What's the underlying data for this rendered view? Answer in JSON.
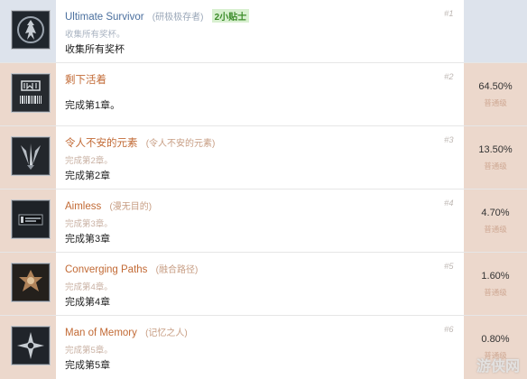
{
  "achievements": [
    {
      "name": "Ultimate Survivor",
      "subtitle": "(研极极存者)",
      "tips": "2小贴士",
      "desc_hidden": "收集所有奖杯。",
      "desc": "收集所有奖杯",
      "num": "#1",
      "percent": "",
      "rarity": "",
      "icon": "survivor-figure-icon",
      "unlocked": true
    },
    {
      "name": "剩下活着",
      "subtitle": "",
      "tips": "",
      "desc_hidden": "",
      "desc": "完成第1章。",
      "num": "#2",
      "percent": "64.50%",
      "rarity": "普通级",
      "icon": "left-alive-barcode-icon",
      "unlocked": false
    },
    {
      "name": "令人不安的元素",
      "subtitle": "(令人不安的元素)",
      "tips": "",
      "desc_hidden": "完成第2章。",
      "desc": "完成第2章",
      "num": "#3",
      "percent": "13.50%",
      "rarity": "普通级",
      "icon": "claw-blades-icon",
      "unlocked": false
    },
    {
      "name": "Aimless",
      "subtitle": "(漫无目的)",
      "tips": "",
      "desc_hidden": "完成第3章。",
      "desc": "完成第3章",
      "num": "#4",
      "percent": "4.70%",
      "rarity": "普通级",
      "icon": "aimless-card-icon",
      "unlocked": false
    },
    {
      "name": "Converging Paths",
      "subtitle": "(融合路径)",
      "tips": "",
      "desc_hidden": "完成第4章。",
      "desc": "完成第4章",
      "num": "#5",
      "percent": "1.60%",
      "rarity": "普通级",
      "icon": "emblem-icon",
      "unlocked": false
    },
    {
      "name": "Man of Memory",
      "subtitle": "(记忆之人)",
      "tips": "",
      "desc_hidden": "完成第5章。",
      "desc": "完成第5章",
      "num": "#6",
      "percent": "0.80%",
      "rarity": "普通级",
      "icon": "compass-star-icon",
      "unlocked": false
    }
  ],
  "watermark": "游侠网"
}
